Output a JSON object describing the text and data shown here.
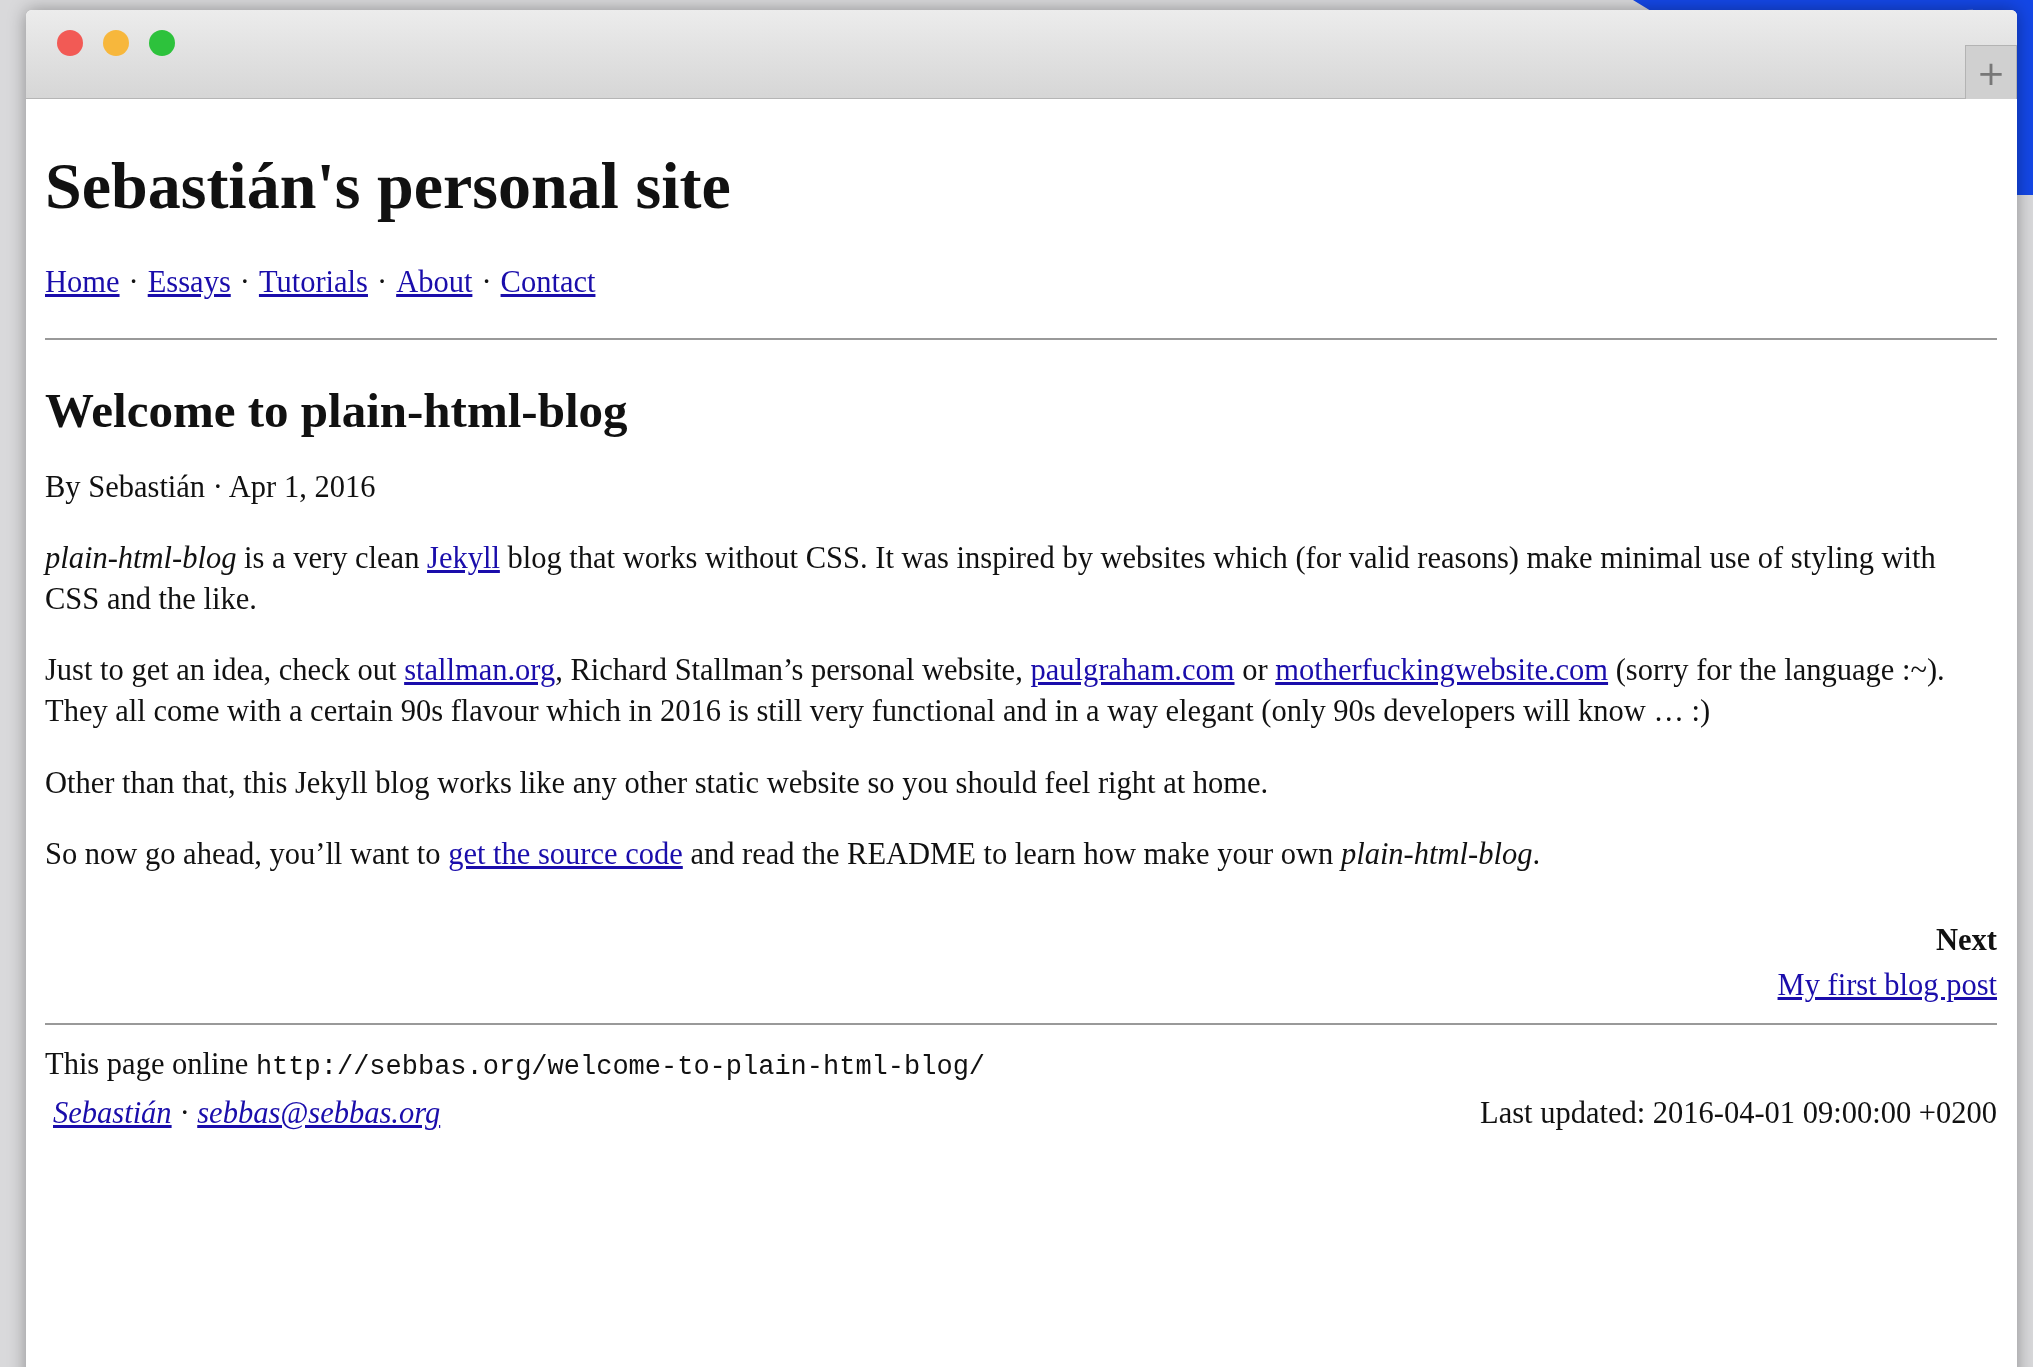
{
  "window": {
    "buttons": [
      {
        "kind": "close"
      },
      {
        "kind": "minimize"
      },
      {
        "kind": "zoom"
      }
    ],
    "new_tab": "+"
  },
  "site_title": "Sebastián's personal site",
  "nav": {
    "links": [
      "Home",
      "Essays",
      "Tutorials",
      "About",
      "Contact"
    ],
    "separator": "·"
  },
  "post": {
    "title": "Welcome to plain-html-blog",
    "byline": "By Sebastián · Apr 1, 2016",
    "paragraphs": [
      [
        {
          "kind": "text",
          "text": "*plain-html-blog* is a very clean "
        },
        {
          "kind": "link",
          "text": "Jekyll"
        },
        {
          "kind": "text",
          "text": " blog that works without CSS. It was inspired by websites which (for valid reasons) make minimal use of styling with CSS and the like."
        }
      ],
      [
        {
          "kind": "text",
          "text": "Just to get an idea, check out "
        },
        {
          "kind": "link",
          "text": "stallman.org"
        },
        {
          "kind": "text",
          "text": ", Richard Stallman’s personal website, "
        },
        {
          "kind": "link",
          "text": "paulgraham.com"
        },
        {
          "kind": "text",
          "text": " or "
        },
        {
          "kind": "link",
          "text": "motherfuckingwebsite.com"
        },
        {
          "kind": "text",
          "text": " (sorry for the language :~). They all come with a certain 90s flavour which in 2016 is still very functional and in a way elegant (only 90s developers will know … :)"
        }
      ],
      [
        {
          "kind": "text",
          "text": "Other than that, this Jekyll blog works like any other static website so you should feel right at home."
        }
      ],
      [
        {
          "kind": "text",
          "text": "So now go ahead, you’ll want to "
        },
        {
          "kind": "link",
          "text": "get the source code"
        },
        {
          "kind": "text",
          "text": " and read the README to learn how make your own *plain-html-blog*."
        }
      ]
    ],
    "next": {
      "label": "Next",
      "link": "My first blog post"
    }
  },
  "footer": {
    "online_label": "This page online",
    "url": "http://sebbas.org/welcome-to-plain-html-blog/",
    "author_links": [
      "Sebastián",
      "sebbas@sebbas.org"
    ],
    "separator": "·",
    "updated": "Last updated: 2016-04-01 09:00:00 +0200"
  }
}
